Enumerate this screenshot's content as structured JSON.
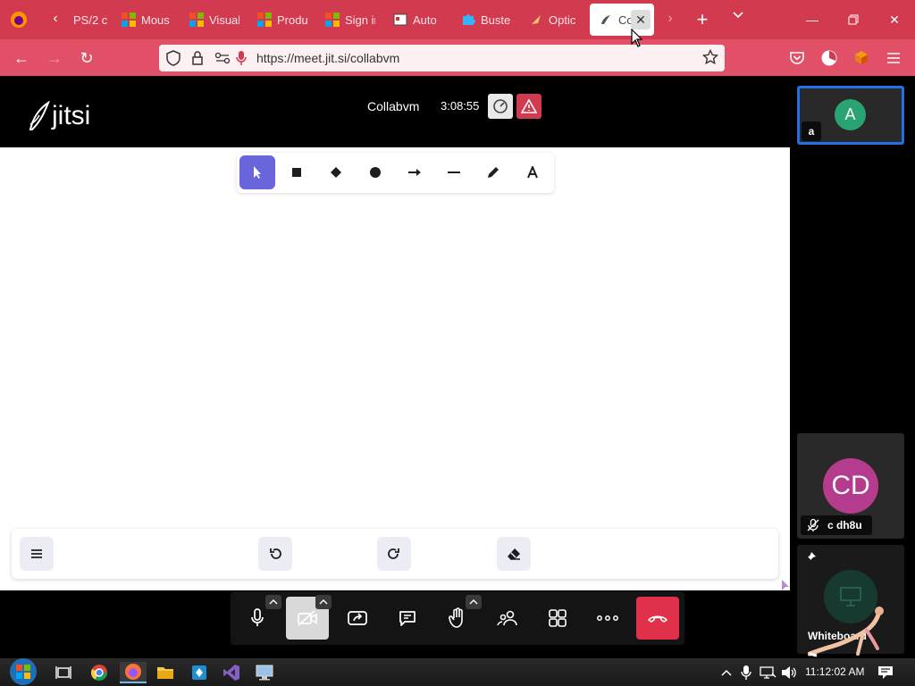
{
  "browser": {
    "tabs": [
      {
        "label": "PS/2 c",
        "icon": "ps2-icon"
      },
      {
        "label": "Mous",
        "icon": "microsoft-icon"
      },
      {
        "label": "Visual",
        "icon": "microsoft-icon"
      },
      {
        "label": "Produ",
        "icon": "microsoft-icon"
      },
      {
        "label": "Sign in",
        "icon": "microsoft-icon"
      },
      {
        "label": "Auto",
        "icon": "auto-icon"
      },
      {
        "label": "Buste",
        "icon": "puzzle-icon"
      },
      {
        "label": "Optic",
        "icon": "optic-icon"
      },
      {
        "label": "Co",
        "icon": "jitsi-icon",
        "active": true
      }
    ],
    "url": "https://meet.jit.si/collabvm"
  },
  "meeting": {
    "logo": "jitsi",
    "title": "Collabvm",
    "timer": "3:08:55"
  },
  "whiteboard": {
    "tools": [
      "selection-icon",
      "rectangle-icon",
      "diamond-icon",
      "ellipse-icon",
      "arrow-icon",
      "line-icon",
      "pencil-icon",
      "text-icon"
    ],
    "selected_tool": "selection-icon"
  },
  "participants": [
    {
      "avatar": "A",
      "name": "a",
      "color": "#29a371"
    },
    {
      "avatar": "CD",
      "name": "c dh8u",
      "color": "#b43b8e"
    },
    {
      "name": "Whiteboard"
    }
  ],
  "taskbar": {
    "clock": "11:12:02 AM"
  },
  "colors": {
    "browser_accent": "#d23a4f",
    "whiteboard_selected": "#6965db",
    "hangup": "#e0304a"
  }
}
